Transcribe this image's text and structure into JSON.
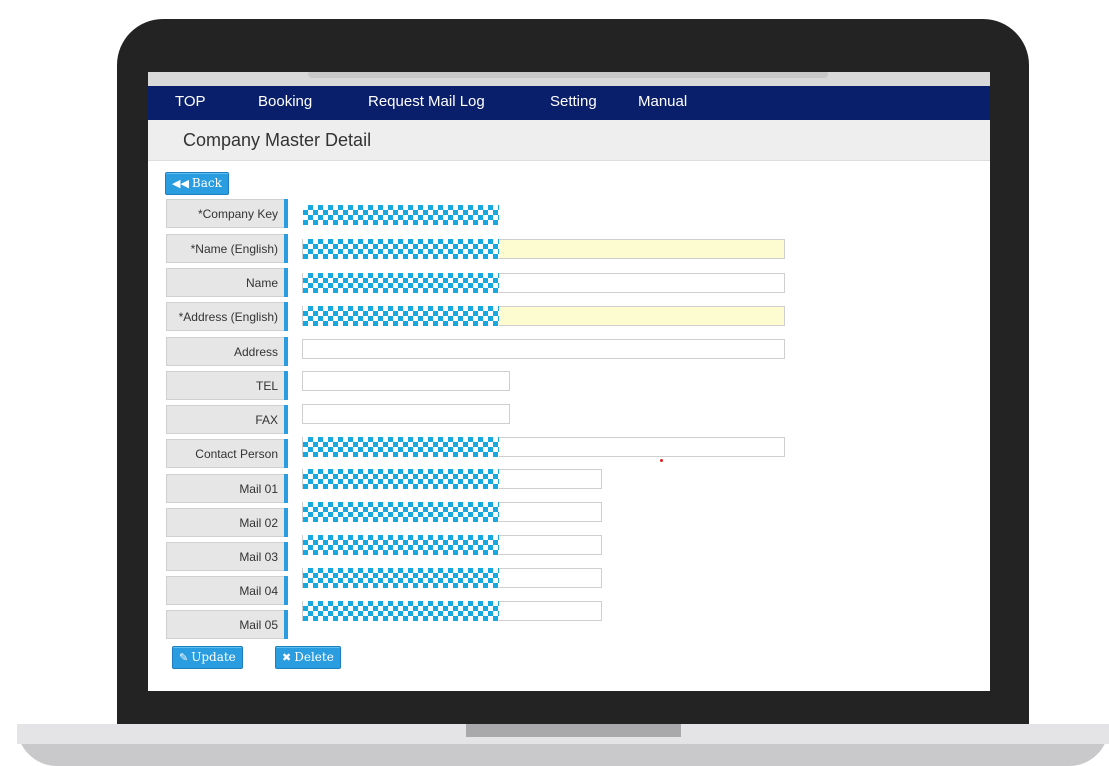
{
  "nav": {
    "items": [
      "TOP",
      "Booking",
      "Request Mail Log",
      "Setting",
      "Manual"
    ]
  },
  "page": {
    "title": "Company Master Detail"
  },
  "buttons": {
    "back": "Back",
    "update": "Update",
    "delete": "Delete"
  },
  "form": {
    "fields": [
      {
        "label": "*Company Key"
      },
      {
        "label": "*Name (English)"
      },
      {
        "label": "Name"
      },
      {
        "label": "*Address (English)"
      },
      {
        "label": "Address"
      },
      {
        "label": "TEL"
      },
      {
        "label": "FAX"
      },
      {
        "label": "Contact Person"
      },
      {
        "label": "Mail 01"
      },
      {
        "label": "Mail 02"
      },
      {
        "label": "Mail 03"
      },
      {
        "label": "Mail 04"
      },
      {
        "label": "Mail 05"
      }
    ]
  },
  "colors": {
    "nav_bg": "#0a1f6b",
    "button_blue": "#2a9de0",
    "required_field_bg": "#fdfcd0",
    "redaction_pattern": "#17a8e0"
  },
  "icons": {
    "back": "double-chevron-left-icon",
    "update": "edit-icon",
    "delete": "close-icon"
  }
}
